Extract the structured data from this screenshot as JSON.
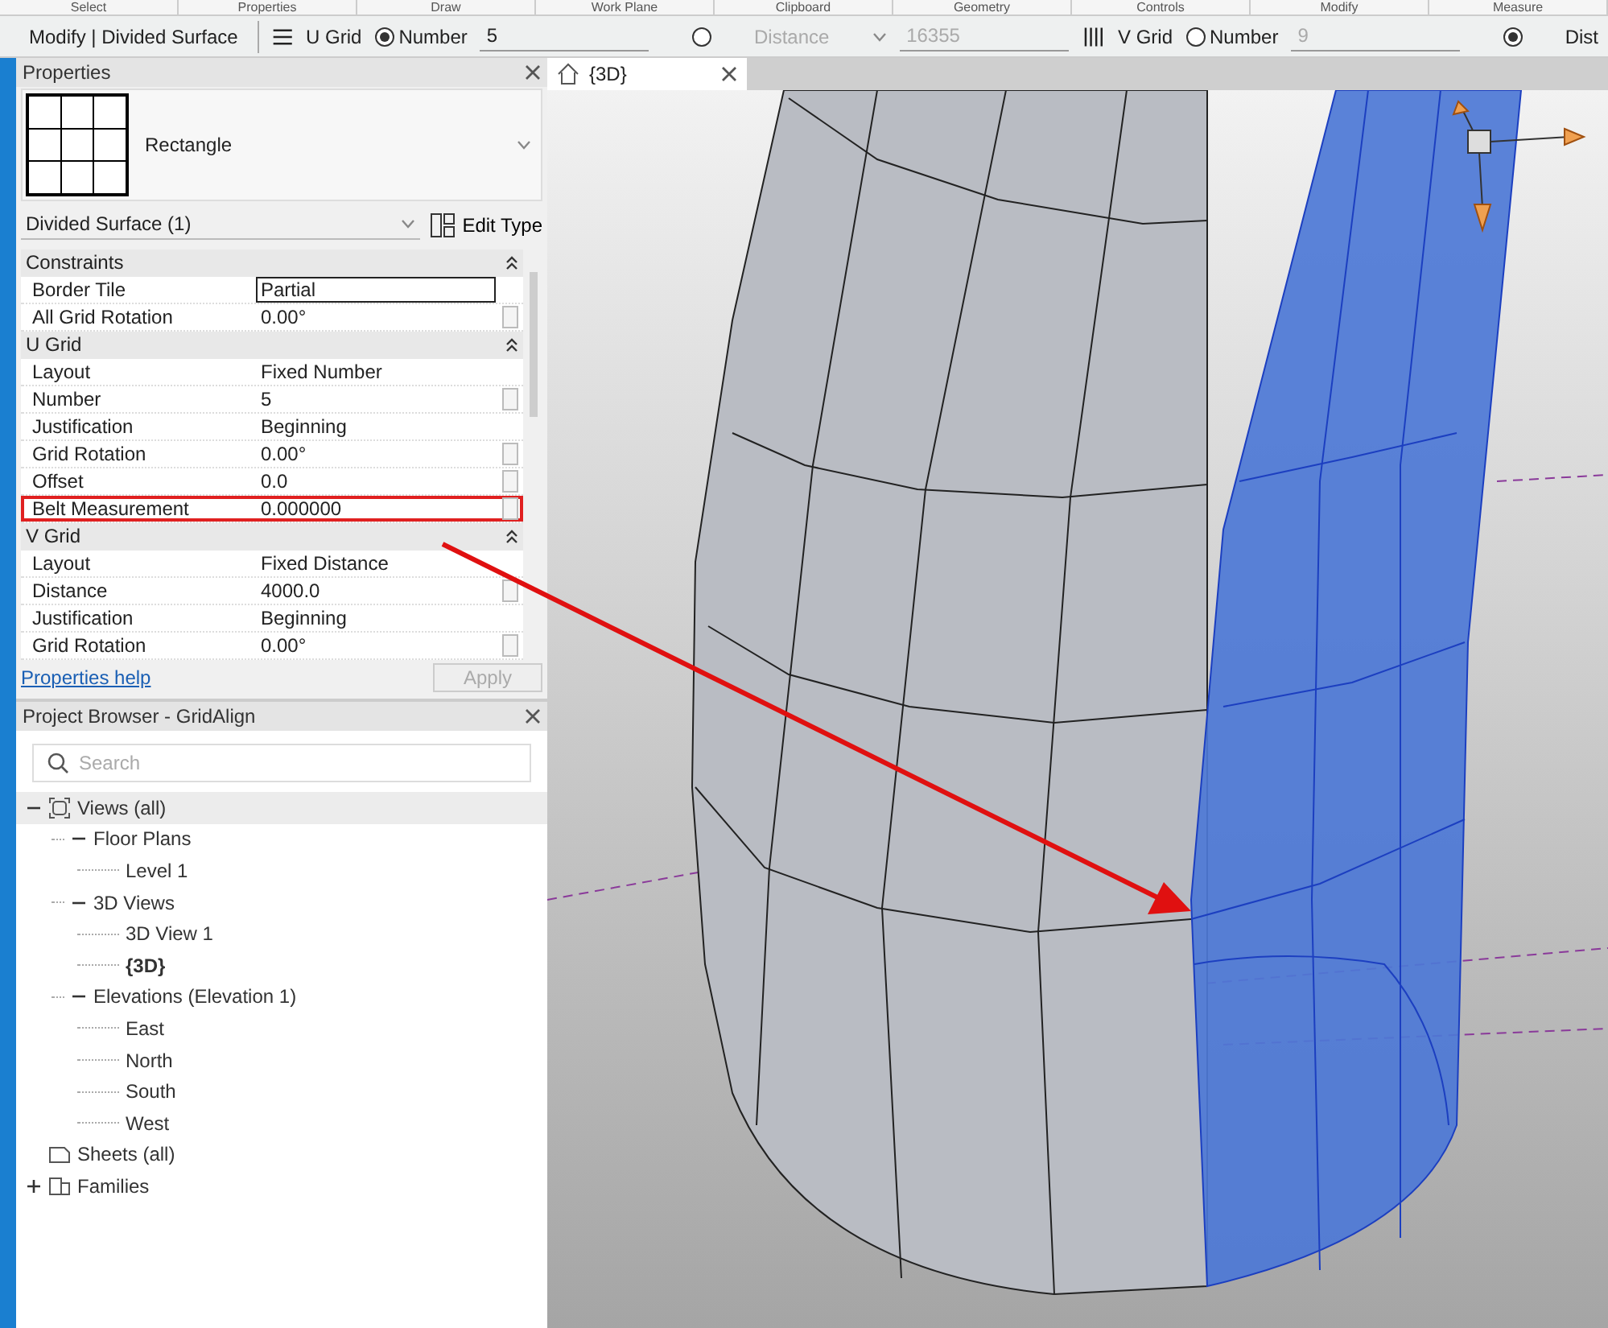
{
  "ribbon_panels": [
    "Select",
    "Properties",
    "Draw",
    "Work Plane",
    "Clipboard",
    "Geometry",
    "Controls",
    "Modify",
    "Measure"
  ],
  "options_bar": {
    "context": "Modify | Divided Surface",
    "items": [
      {
        "kind": "rows-icon"
      },
      {
        "kind": "label",
        "text": "U Grid"
      },
      {
        "kind": "radio",
        "label": "Number",
        "selected": true
      },
      {
        "kind": "field",
        "value": "5",
        "disabled": false
      },
      {
        "kind": "radio",
        "selected": false
      },
      {
        "kind": "dropdown",
        "value": "Distance",
        "disabled": true
      },
      {
        "kind": "field",
        "value": "16355",
        "disabled": true
      },
      {
        "kind": "columns-icon"
      },
      {
        "kind": "label",
        "text": "V Grid"
      },
      {
        "kind": "radio",
        "label": "Number",
        "selected": false
      },
      {
        "kind": "field",
        "value": "9",
        "disabled": true
      },
      {
        "kind": "radio",
        "selected": true
      },
      {
        "kind": "label",
        "text": "Dist"
      }
    ]
  },
  "properties": {
    "title": "Properties",
    "type_name": "Rectangle",
    "instance": "Divided Surface (1)",
    "edit_type": "Edit Type",
    "rows": [
      {
        "kind": "group",
        "label": "Constraints"
      },
      {
        "kind": "param",
        "label": "Border Tile",
        "value": "Partial",
        "editing": true,
        "linkable": false,
        "highlighted": false
      },
      {
        "kind": "param",
        "label": "All Grid Rotation",
        "value": "0.00°",
        "editing": false,
        "linkable": true,
        "highlighted": false
      },
      {
        "kind": "group",
        "label": "U Grid"
      },
      {
        "kind": "param",
        "label": "Layout",
        "value": "Fixed Number",
        "editing": false,
        "linkable": false,
        "highlighted": false
      },
      {
        "kind": "param",
        "label": "Number",
        "value": "5",
        "editing": false,
        "linkable": true,
        "highlighted": false
      },
      {
        "kind": "param",
        "label": "Justification",
        "value": "Beginning",
        "editing": false,
        "linkable": false,
        "highlighted": false
      },
      {
        "kind": "param",
        "label": "Grid Rotation",
        "value": "0.00°",
        "editing": false,
        "linkable": true,
        "highlighted": false
      },
      {
        "kind": "param",
        "label": "Offset",
        "value": "0.0",
        "editing": false,
        "linkable": true,
        "highlighted": false
      },
      {
        "kind": "param",
        "label": "Belt Measurement",
        "value": "0.000000",
        "editing": false,
        "linkable": true,
        "highlighted": true
      },
      {
        "kind": "group",
        "label": "V Grid"
      },
      {
        "kind": "param",
        "label": "Layout",
        "value": "Fixed Distance",
        "editing": false,
        "linkable": false,
        "highlighted": false
      },
      {
        "kind": "param",
        "label": "Distance",
        "value": "4000.0",
        "editing": false,
        "linkable": true,
        "highlighted": false
      },
      {
        "kind": "param",
        "label": "Justification",
        "value": "Beginning",
        "editing": false,
        "linkable": false,
        "highlighted": false
      },
      {
        "kind": "param",
        "label": "Grid Rotation",
        "value": "0.00°",
        "editing": false,
        "linkable": true,
        "highlighted": false
      }
    ],
    "help_link": "Properties help",
    "apply": {
      "label": "Apply",
      "disabled": true
    }
  },
  "project_browser": {
    "title": "Project Browser - GridAlign",
    "search": {
      "placeholder": "Search"
    },
    "tree": [
      {
        "label": "Views (all)",
        "kind": "views",
        "expanded": true,
        "selected": true,
        "bold": false,
        "children": [
          {
            "label": "Floor Plans",
            "kind": "folder",
            "expanded": true,
            "selected": false,
            "bold": false,
            "children": [
              {
                "label": "Level 1",
                "selected": false,
                "bold": false
              }
            ]
          },
          {
            "label": "3D Views",
            "kind": "folder",
            "expanded": true,
            "selected": false,
            "bold": false,
            "children": [
              {
                "label": "3D View 1",
                "selected": false,
                "bold": false
              },
              {
                "label": "{3D}",
                "selected": false,
                "bold": true
              }
            ]
          },
          {
            "label": "Elevations (Elevation 1)",
            "kind": "folder",
            "expanded": true,
            "selected": false,
            "bold": false,
            "children": [
              {
                "label": "East",
                "selected": false,
                "bold": false
              },
              {
                "label": "North",
                "selected": false,
                "bold": false
              },
              {
                "label": "South",
                "selected": false,
                "bold": false
              },
              {
                "label": "West",
                "selected": false,
                "bold": false
              }
            ]
          }
        ]
      },
      {
        "label": "Sheets (all)",
        "kind": "sheets",
        "selected": false,
        "bold": false
      },
      {
        "label": "Families",
        "kind": "families",
        "expanded": false,
        "selected": false,
        "bold": false
      }
    ]
  },
  "view_tab": {
    "label": "{3D}",
    "selected": true
  }
}
